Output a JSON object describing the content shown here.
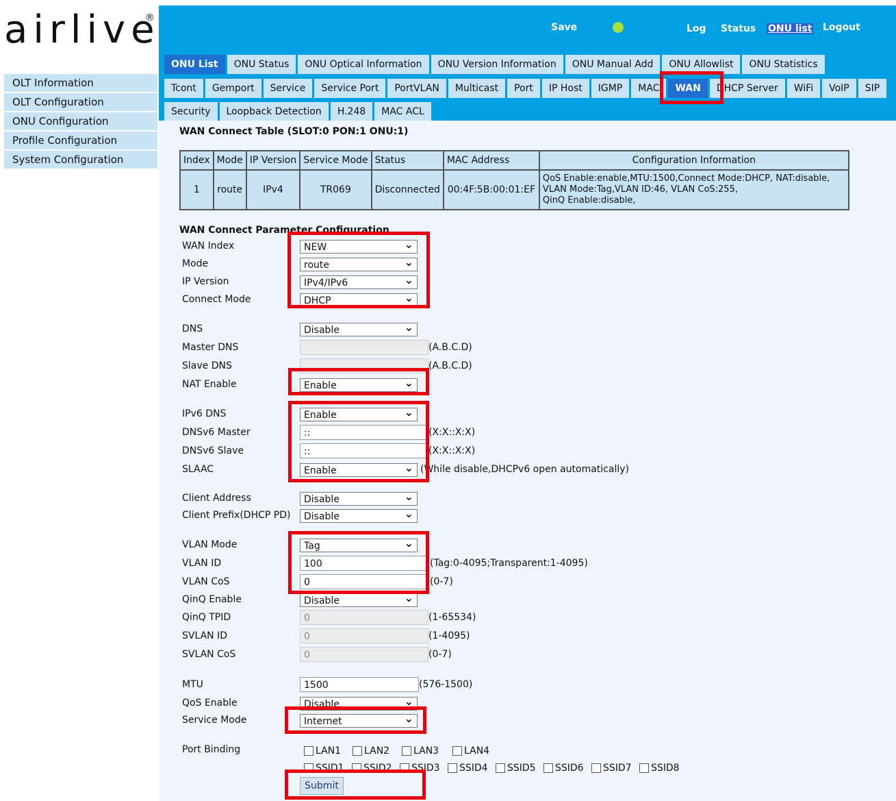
{
  "logo": {
    "text": "airlive",
    "registered": "®"
  },
  "sidebar": {
    "items": [
      {
        "label": "OLT Information"
      },
      {
        "label": "OLT Configuration"
      },
      {
        "label": "ONU Configuration"
      },
      {
        "label": "Profile Configuration"
      },
      {
        "label": "System Configuration"
      }
    ]
  },
  "topbar": {
    "save": "Save",
    "log": "Log",
    "status": "Status",
    "onu_list": "ONU list",
    "logout": "Logout",
    "status_dot_color": "#a6e03a"
  },
  "tabs": {
    "row1": [
      "ONU List",
      "ONU Status",
      "ONU Optical Information",
      "ONU Version Information",
      "ONU Manual Add",
      "ONU Allowlist",
      "ONU Statistics"
    ],
    "row2": [
      "Tcont",
      "Gemport",
      "Service",
      "Service Port",
      "PortVLAN",
      "Multicast",
      "Port",
      "IP Host",
      "IGMP",
      "MAC",
      "WAN",
      "DHCP Server",
      "WiFi",
      "VoIP",
      "SIP"
    ],
    "row3": [
      "Security",
      "Loopback Detection",
      "H.248",
      "MAC ACL"
    ],
    "active_row1": "ONU List",
    "active_row2": "WAN"
  },
  "wan_table": {
    "title": "WAN Connect Table (SLOT:0 PON:1 ONU:1)",
    "headers": [
      "Index",
      "Mode",
      "IP Version",
      "Service Mode",
      "Status",
      "MAC Address",
      "Configuration Information"
    ],
    "rows": [
      {
        "index": "1",
        "mode": "route",
        "ip_version": "IPv4",
        "service_mode": "TR069",
        "status": "Disconnected",
        "mac": "00:4F:5B:00:01:EF",
        "config_1": "QoS Enable:enable,MTU:1500,Connect Mode:DHCP, NAT:disable,",
        "config_2": "VLAN Mode:Tag,VLAN ID:46, VLAN CoS:255,",
        "config_3": "QinQ Enable:disable,"
      }
    ]
  },
  "param": {
    "title": "WAN Connect Parameter Configuration",
    "wan_index": {
      "label": "WAN Index",
      "value": "NEW"
    },
    "mode": {
      "label": "Mode",
      "value": "route"
    },
    "ip_version": {
      "label": "IP Version",
      "value": "IPv4/IPv6"
    },
    "connect_mode": {
      "label": "Connect Mode",
      "value": "DHCP"
    },
    "dns": {
      "label": "DNS",
      "value": "Disable"
    },
    "master_dns": {
      "label": "Master DNS",
      "value": "",
      "hint": "(A.B.C.D)"
    },
    "slave_dns": {
      "label": "Slave DNS",
      "value": "",
      "hint": "(A.B.C.D)"
    },
    "nat": {
      "label": "NAT Enable",
      "value": "Enable"
    },
    "ipv6_dns": {
      "label": "IPv6 DNS",
      "value": "Enable"
    },
    "dnsv6_master": {
      "label": "DNSv6 Master",
      "value": "::",
      "hint": "(X:X::X:X)"
    },
    "dnsv6_slave": {
      "label": "DNSv6 Slave",
      "value": "::",
      "hint": "(X:X::X:X)"
    },
    "slaac": {
      "label": "SLAAC",
      "value": "Enable",
      "hint": "(While disable,DHCPv6 open automatically)"
    },
    "client_address": {
      "label": "Client Address",
      "value": "Disable"
    },
    "client_prefix": {
      "label": "Client Prefix(DHCP PD)",
      "value": "Disable"
    },
    "vlan_mode": {
      "label": "VLAN Mode",
      "value": "Tag"
    },
    "vlan_id": {
      "label": "VLAN ID",
      "value": "100",
      "hint": "(Tag:0-4095;Transparent:1-4095)"
    },
    "vlan_cos": {
      "label": "VLAN CoS",
      "value": "0",
      "hint": "(0-7)"
    },
    "qinq": {
      "label": "QinQ Enable",
      "value": "Disable"
    },
    "qinq_tpid": {
      "label": "QinQ TPID",
      "value": "0",
      "hint": "(1-65534)"
    },
    "svlan_id": {
      "label": "SVLAN ID",
      "value": "0",
      "hint": "(1-4095)"
    },
    "svlan_cos": {
      "label": "SVLAN CoS",
      "value": "0",
      "hint": "(0-7)"
    },
    "mtu": {
      "label": "MTU",
      "value": "1500",
      "hint": "(576-1500)"
    },
    "qos": {
      "label": "QoS Enable",
      "value": "Disable"
    },
    "service_mode": {
      "label": "Service Mode",
      "value": "Internet"
    },
    "port_binding": {
      "label": "Port Binding",
      "lan": [
        "LAN1",
        "LAN2",
        "LAN3",
        "LAN4"
      ],
      "ssid": [
        "SSID1",
        "SSID2",
        "SSID3",
        "SSID4",
        "SSID5",
        "SSID6",
        "SSID7",
        "SSID8"
      ]
    },
    "submit": "Submit"
  },
  "highlight_color": "#e8000f"
}
